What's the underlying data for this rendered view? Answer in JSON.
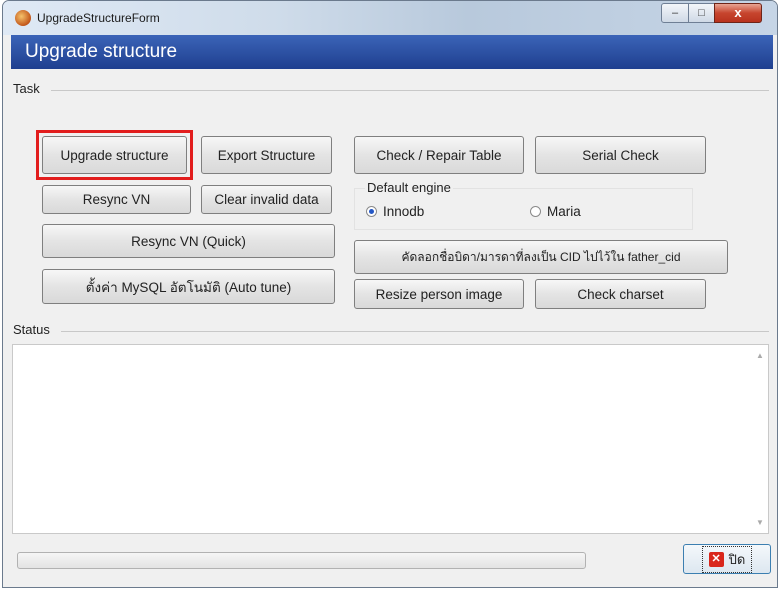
{
  "window": {
    "title": "UpgradeStructureForm",
    "controls": {
      "minimize": "–",
      "maximize": "□",
      "close": "x"
    }
  },
  "header": {
    "title": "Upgrade structure"
  },
  "task": {
    "label": "Task",
    "buttons": {
      "upgrade_structure": "Upgrade structure",
      "export_structure": "Export Structure",
      "check_repair_table": "Check / Repair Table",
      "serial_check": "Serial Check",
      "resync_vn": "Resync VN",
      "clear_invalid_data": "Clear invalid data",
      "resync_vn_quick": "Resync VN (Quick)",
      "copy_parent_cid": "คัดลอกชื่อบิดา/มารดาที่ลงเป็น CID ไปไว้ใน father_cid",
      "mysql_auto_tune": "ตั้งค่า MySQL อัตโนมัติ (Auto tune)",
      "resize_person_image": "Resize person image",
      "check_charset": "Check charset"
    },
    "default_engine": {
      "label": "Default engine",
      "options": [
        "Innodb",
        "Maria"
      ],
      "selected": "Innodb"
    }
  },
  "status": {
    "label": "Status",
    "text": ""
  },
  "footer": {
    "progress": 0,
    "close_label": "ปิด"
  },
  "colors": {
    "header_bg": "#2a4fa3",
    "highlight_border": "#e21d1d",
    "close_icon": "#d9271c"
  }
}
